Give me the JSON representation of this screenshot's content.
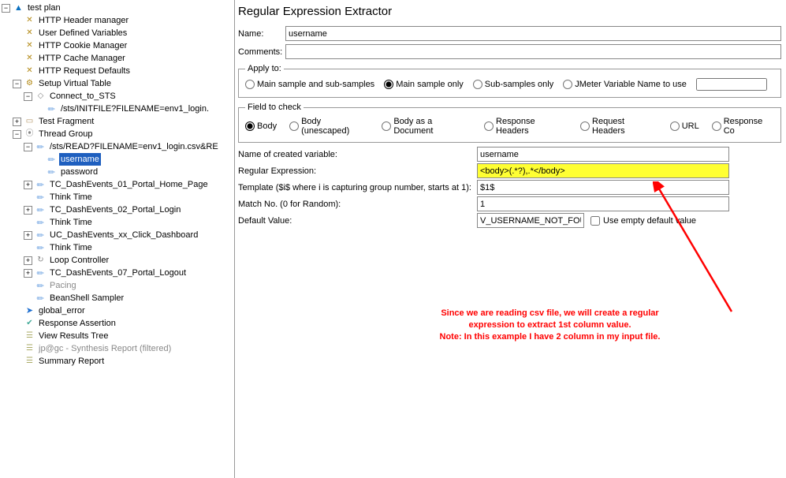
{
  "tree": {
    "root": "test plan",
    "items": [
      "HTTP Header manager",
      "User Defined Variables",
      "HTTP Cookie Manager",
      "HTTP Cache Manager",
      "HTTP Request Defaults"
    ],
    "svt": "Setup Virtual Table",
    "connect": "Connect_to_STS",
    "initfile": "/sts/INITFILE?FILENAME=env1_login.",
    "testfrag": "Test Fragment",
    "tg": "Thread Group",
    "readfile": "/sts/READ?FILENAME=env1_login.csv&RE",
    "username": "username",
    "password": "password",
    "tcs": [
      "TC_DashEvents_01_Portal_Home_Page",
      "Think Time",
      "TC_DashEvents_02_Portal_Login",
      "Think Time",
      "UC_DashEvents_xx_Click_Dashboard",
      "Think Time",
      "Loop Controller",
      "TC_DashEvents_07_Portal_Logout"
    ],
    "pacing": "Pacing",
    "beanshell": "BeanShell Sampler",
    "global_error": "global_error",
    "resp_assert": "Response Assertion",
    "view_results": "View Results Tree",
    "synth": "jp@gc - Synthesis Report (filtered)",
    "summary": "Summary Report"
  },
  "panel": {
    "title": "Regular Expression Extractor",
    "name_label": "Name:",
    "name_value": "username",
    "comments_label": "Comments:",
    "comments_value": "",
    "apply_legend": "Apply to:",
    "apply_options": [
      "Main sample and sub-samples",
      "Main sample only",
      "Sub-samples only",
      "JMeter Variable Name to use"
    ],
    "apply_selected": 1,
    "field_legend": "Field to check",
    "field_options": [
      "Body",
      "Body (unescaped)",
      "Body as a Document",
      "Response Headers",
      "Request Headers",
      "URL",
      "Response Co"
    ],
    "field_selected": 0,
    "rows": {
      "var_label": "Name of created variable:",
      "var_value": "username",
      "regex_label": "Regular Expression:",
      "regex_value": "<body>(.*?),.*</body>",
      "tmpl_label": "Template ($i$ where i is capturing group number, starts at 1):",
      "tmpl_value": "$1$",
      "match_label": "Match No. (0 for Random):",
      "match_value": "1",
      "default_label": "Default Value:",
      "default_value": "V_USERNAME_NOT_FOUND",
      "empty_label": "Use empty default value"
    }
  },
  "annotation": {
    "line1": "Since we are reading csv file, we will create a regular",
    "line2": "expression to extract 1st column value.",
    "line3": "Note: In this example I have 2 column in my input file."
  }
}
